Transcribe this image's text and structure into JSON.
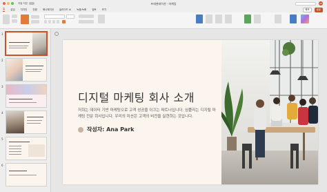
{
  "titlebar": {
    "autosave_label": "자동 저장",
    "title": "프레젠테이션 - 마케팅",
    "account_initials": "AP"
  },
  "tabs": [
    {
      "label": "홈",
      "active": true
    },
    {
      "label": "삽입"
    },
    {
      "label": "디자인"
    },
    {
      "label": "전환"
    },
    {
      "label": "애니메이션"
    },
    {
      "label": "슬라이드 쇼"
    },
    {
      "label": "녹음/녹화"
    },
    {
      "label": "검토"
    },
    {
      "label": "보기"
    }
  ],
  "tab_actions": {
    "comment_label": "메모",
    "share_label": "공유"
  },
  "slide_panel": {
    "numbers": [
      "1",
      "2",
      "3",
      "4",
      "5",
      "6"
    ]
  },
  "slide": {
    "title": "디지털 마케팅 회사 소개",
    "description": "저희는 데이터 기반 마케팅으로 고객 성공을 이끄는 파트너입니다. 심플리는 디지털 마케팅 전문 회사입니다. 우리의 미션은 고객의 비전을 실현하는 것입니다.",
    "author": "작성자: Ana Park"
  },
  "colors": {
    "accent": "#c8512a",
    "slide_bg": "#fbf5ee",
    "author_dot": "#c7b5a4"
  }
}
